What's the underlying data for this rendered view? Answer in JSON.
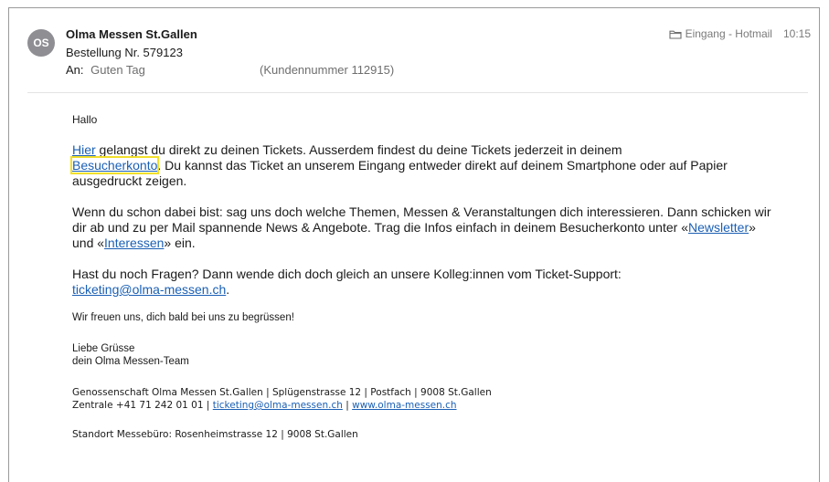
{
  "header": {
    "avatar_initials": "OS",
    "sender": "Olma Messen St.Gallen",
    "subject": "Bestellung Nr. 579123",
    "to_label": "An:",
    "to_name": "Guten Tag",
    "customer_number": "(Kundennummer 112915)",
    "folder": "Eingang - Hotmail",
    "time": "10:15",
    "folder_icon": "folder-icon"
  },
  "body": {
    "greeting": "Hallo",
    "p1": {
      "link_hier": "Hier",
      "text_a": " gelangst du direkt zu deinen Tickets. Ausserdem findest du deine Tickets jederzeit in deinem",
      "link_besucherkonto": "Besucherkonto",
      "text_b": ". Du kannst das Ticket an unserem Eingang entweder direkt auf deinem Smartphone oder auf Papier ausgedruckt zeigen."
    },
    "p2": {
      "text_a": "Wenn du schon dabei bist: sag uns doch welche Themen, Messen & Veranstaltungen dich interessieren. Dann schicken wir dir ab und zu per Mail spannende News & Angebote. Trag die Infos einfach in deinem Besucherkonto unter «",
      "link_newsletter": "Newsletter",
      "text_b": "» und «",
      "link_interessen": "Interessen",
      "text_c": "» ein."
    },
    "p3": {
      "text_a": "Hast du noch Fragen? Dann wende dich doch gleich an unsere Kolleg:innen vom Ticket-Support:",
      "link_email": "ticketing@olma-messen.ch",
      "text_b": "."
    },
    "p4": "Wir freuen uns, dich bald bei uns zu begrüssen!",
    "signoff_1": "Liebe Grüsse",
    "signoff_2": "dein Olma Messen-Team",
    "footer": {
      "line1": "Genossenschaft Olma Messen St.Gallen | Splügenstrasse 12 | Postfach | 9008 St.Gallen",
      "line2_prefix": "Zentrale +41 71 242 01 01 | ",
      "link_email": "ticketing@olma-messen.ch",
      "sep": " | ",
      "link_web": "www.olma-messen.ch",
      "line3": "Standort Messebüro: Rosenheimstrasse 12 | 9008 St.Gallen"
    }
  },
  "colors": {
    "link": "#1a5fb4",
    "highlight": "#f2df2c",
    "avatar": "#8e8e93"
  }
}
